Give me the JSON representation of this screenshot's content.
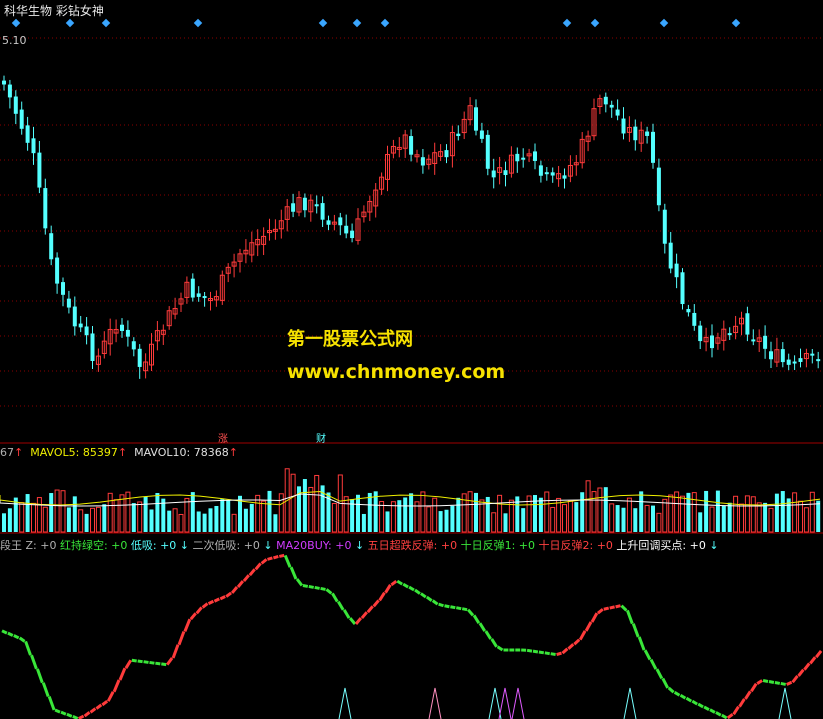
{
  "header": {
    "title": "科华生物 彩钻女神",
    "price_tick": "5.10"
  },
  "watermark": {
    "line1": "第一股票公式网",
    "line2": "www.chnmoney.com"
  },
  "events": {
    "rise_label": "涨",
    "finance_label": "财"
  },
  "volume_legend": {
    "vol_tail": "67",
    "ma5_label": "MAVOL5:",
    "ma5_value": "85397",
    "ma10_label": "MAVOL10:",
    "ma10_value": "78368",
    "ma5_arrow": "↑",
    "ma10_arrow": "↑",
    "vol_arrow": "↑"
  },
  "indicator_legend": {
    "items": [
      {
        "text": "段王",
        "color": "#b0b0b0"
      },
      {
        "text": " Z: +0",
        "color": "#b0b0b0"
      },
      {
        "text": " 红持绿空: +0",
        "color": "#39e639"
      },
      {
        "text": " 低吸: +0",
        "color": "#5ff"
      },
      {
        "text": " ↓",
        "color": "#5ff"
      },
      {
        "text": " 二次低吸: +0",
        "color": "#b0b0b0"
      },
      {
        "text": " ↓",
        "color": "#5ff"
      },
      {
        "text": " MA20BUY: +0",
        "color": "#d13cff"
      },
      {
        "text": " ↓",
        "color": "#5ff"
      },
      {
        "text": " 五日超跌反弹: +0",
        "color": "#ff4040"
      },
      {
        "text": " 十日反弹1: +0",
        "color": "#39e639"
      },
      {
        "text": " 十日反弹2: +0",
        "color": "#ff4040"
      },
      {
        "text": " 上升回调买点: +0",
        "color": "#ffffff"
      },
      {
        "text": " ↓",
        "color": "#5ff"
      }
    ]
  },
  "colors": {
    "up": "#ff3b3b",
    "down": "#54ffff",
    "grid": "#8a0000",
    "marker": "#3aa6ff",
    "watermark": "#f7e200"
  }
}
